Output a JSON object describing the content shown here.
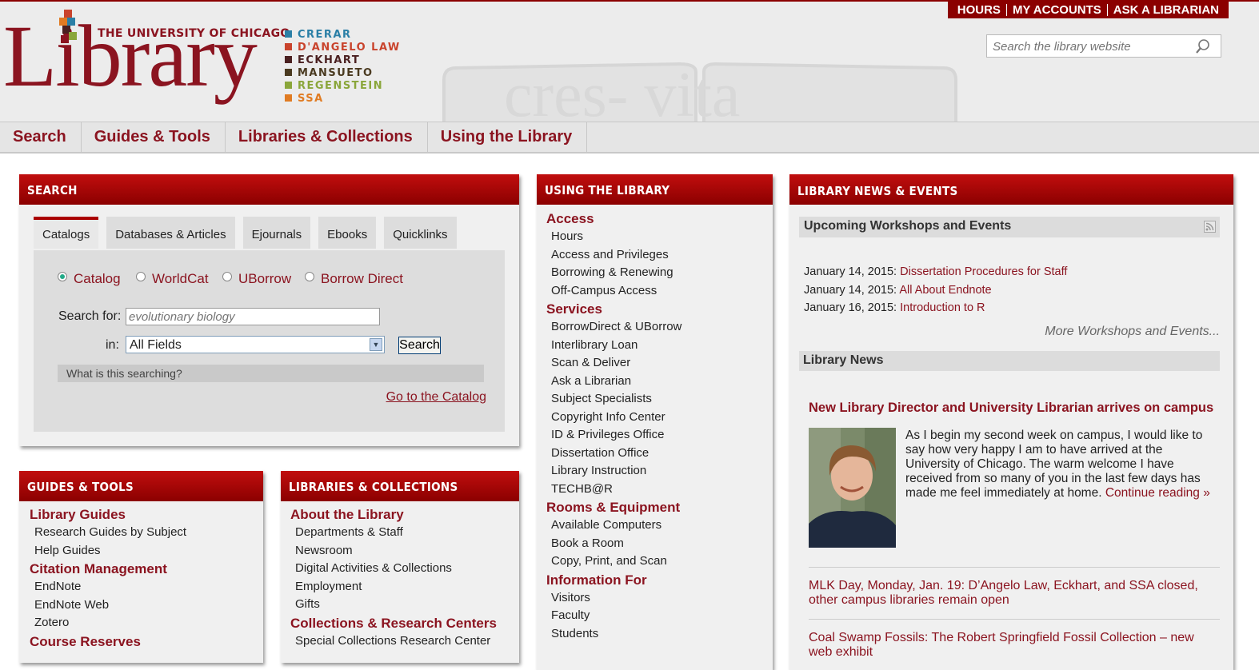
{
  "header": {
    "university": "THE UNIVERSITY OF CHICAGO",
    "logo_word": "Library",
    "libraries": [
      {
        "name": "CRERAR",
        "color": "#2b7fa6"
      },
      {
        "name": "D'ANGELO LAW",
        "color": "#c9432c"
      },
      {
        "name": "ECKHART",
        "color": "#4a2020"
      },
      {
        "name": "MANSUETO",
        "color": "#4a3a20"
      },
      {
        "name": "REGENSTEIN",
        "color": "#8aa63a"
      },
      {
        "name": "SSA",
        "color": "#e07b22"
      }
    ],
    "top_links": [
      "HOURS",
      "MY ACCOUNTS",
      "ASK A LIBRARIAN"
    ],
    "site_search_placeholder": "Search the library website",
    "watermark": "cres- vita"
  },
  "nav": [
    "Search",
    "Guides & Tools",
    "Libraries & Collections",
    "Using the Library"
  ],
  "search_panel": {
    "title": "SEARCH",
    "tabs": [
      "Catalogs",
      "Databases & Articles",
      "Ejournals",
      "Ebooks",
      "Quicklinks"
    ],
    "radios": [
      "Catalog",
      "WorldCat",
      "UBorrow",
      "Borrow Direct"
    ],
    "search_for_label": "Search for:",
    "search_placeholder": "evolutionary biology",
    "in_label": "in:",
    "in_value": "All Fields",
    "search_button": "Search",
    "what_searching": "What is this searching?",
    "go_catalog": "Go to the Catalog"
  },
  "guides_panel": {
    "title": "GUIDES & TOOLS",
    "sections": [
      {
        "heading": "Library Guides",
        "links": [
          "Research Guides by Subject",
          "Help Guides"
        ]
      },
      {
        "heading": "Citation Management",
        "links": [
          "EndNote",
          "EndNote Web",
          "Zotero"
        ]
      },
      {
        "heading": "Course Reserves",
        "links": []
      }
    ]
  },
  "libraries_panel": {
    "title": "LIBRARIES & COLLECTIONS",
    "sections": [
      {
        "heading": "About the Library",
        "links": [
          "Departments & Staff",
          "Newsroom",
          "Digital Activities & Collections",
          "Employment",
          "Gifts"
        ]
      },
      {
        "heading": "Collections & Research Centers",
        "links": [
          "Special Collections Research Center"
        ]
      }
    ]
  },
  "using_panel": {
    "title": "USING THE LIBRARY",
    "sections": [
      {
        "heading": "Access",
        "links": [
          "Hours",
          "Access and Privileges",
          "Borrowing & Renewing",
          "Off-Campus Access"
        ]
      },
      {
        "heading": "Services",
        "links": [
          "BorrowDirect & UBorrow",
          "Interlibrary Loan",
          "Scan & Deliver",
          "Ask a Librarian",
          "Subject Specialists",
          "Copyright Info Center",
          "ID & Privileges Office",
          "Dissertation Office",
          "Library Instruction",
          "TECHB@R"
        ]
      },
      {
        "heading": "Rooms & Equipment",
        "links": [
          "Available Computers",
          "Book a Room",
          "Copy, Print, and Scan"
        ]
      },
      {
        "heading": "Information For",
        "links": [
          "Visitors",
          "Faculty",
          "Students"
        ]
      }
    ]
  },
  "news_panel": {
    "title": "LIBRARY NEWS & EVENTS",
    "events_heading": "Upcoming Workshops and Events",
    "events": [
      {
        "date": "January 14, 2015:",
        "title": "Dissertation Procedures for Staff"
      },
      {
        "date": "January 14, 2015:",
        "title": "All About Endnote"
      },
      {
        "date": "January 16, 2015:",
        "title": "Introduction to R"
      }
    ],
    "more_events": "More Workshops and Events...",
    "news_heading": "Library News",
    "feature_title": "New Library Director and University Librarian arrives on campus",
    "feature_text": "As I begin my second week on campus, I would like to say how very happy I am to have arrived at the University of Chicago. The warm welcome I have received from so many of you in the last few days has made me feel immediately at home.",
    "continue": "Continue reading »",
    "news_items": [
      "MLK Day, Monday, Jan. 19: D’Angelo Law, Eckhart, and SSA closed, other campus libraries remain open",
      "Coal Swamp Fossils: The Robert Springfield Fossil Collection – new web exhibit"
    ]
  }
}
